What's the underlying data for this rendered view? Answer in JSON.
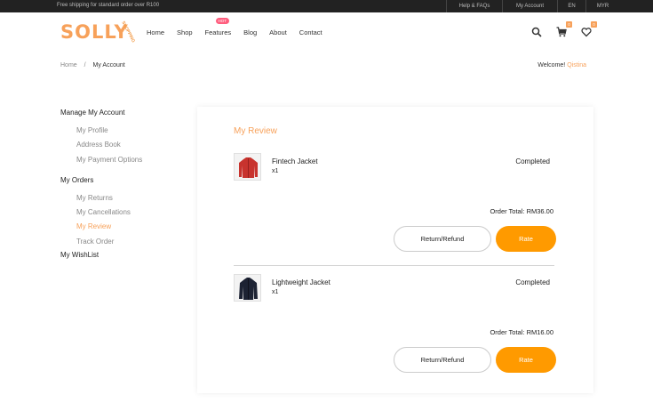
{
  "topbar": {
    "promo": "Free shipping for standard order over R100",
    "links": [
      "Help & FAQs",
      "My Account",
      "EN",
      "MYR"
    ]
  },
  "header": {
    "logo_text": "SOLLY",
    "logo_tag": "SHOPPING",
    "nav": [
      "Home",
      "Shop",
      "Features",
      "Blog",
      "About",
      "Contact"
    ],
    "hot_badge": "HOT",
    "cart_count": "0",
    "wishlist_count": "0"
  },
  "breadcrumb": {
    "home": "Home",
    "separator": "/",
    "current": "My Account"
  },
  "welcome": {
    "label": "Welcome!",
    "name": "Qistina"
  },
  "sidebar": {
    "manage_heading": "Manage My Account",
    "manage_items": [
      "My Profile",
      "Address Book",
      "My Payment Options"
    ],
    "orders_heading": "My Orders",
    "orders_items": [
      "My Returns",
      "My Cancellations",
      "My Review",
      "Track Order"
    ],
    "wishlist_heading": "My WishList"
  },
  "main": {
    "title": "My Review",
    "orders": [
      {
        "product": "Fintech Jacket",
        "qty": "x1",
        "status": "Completed",
        "total": "Order Total: RM36.00",
        "return_label": "Return/Refund",
        "rate_label": "Rate"
      },
      {
        "product": "Lightweight Jacket",
        "qty": "x1",
        "status": "Completed",
        "total": "Order Total: RM16.00",
        "return_label": "Return/Refund",
        "rate_label": "Rate"
      }
    ]
  },
  "colors": {
    "accent": "#f7a15a",
    "button_orange": "#ff9a00",
    "hot_badge": "#ff5e7e",
    "topbar": "#222222"
  },
  "icons": [
    "search-icon",
    "cart-icon",
    "heart-icon"
  ]
}
